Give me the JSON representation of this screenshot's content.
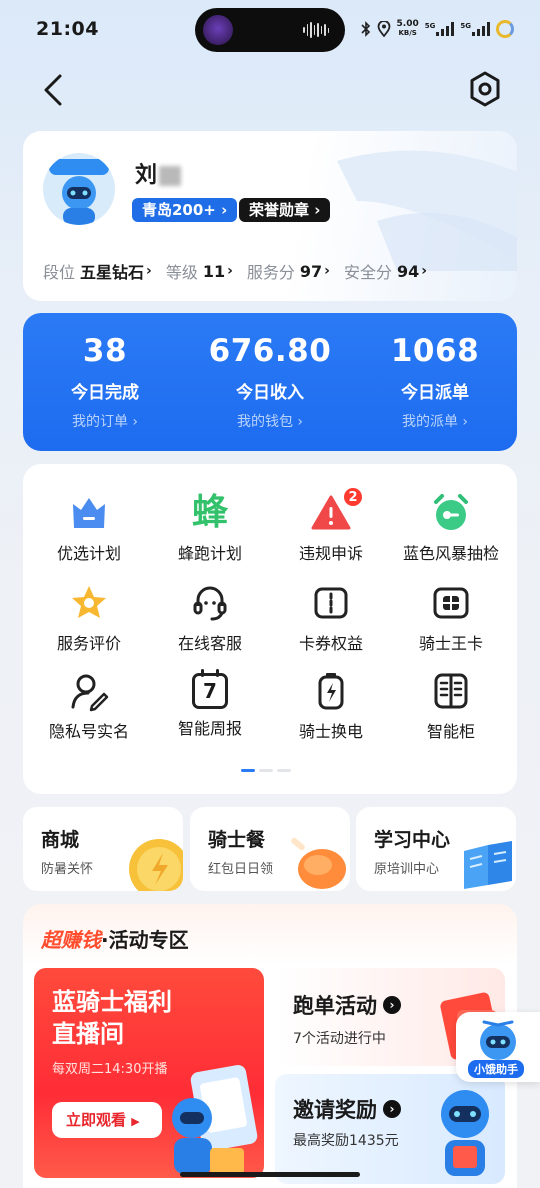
{
  "status_bar": {
    "time": "21:04",
    "speed_value": "5.00",
    "speed_unit": "KB/S",
    "net1": "5G",
    "net2": "5G"
  },
  "nav": {
    "back_icon": "chevron-left-icon",
    "settings_icon": "hexagon-settings-icon"
  },
  "profile": {
    "name_visible": "刘",
    "badge_city": "青岛200+",
    "badge_honor": "荣誉勋章",
    "stats": [
      {
        "label": "段位",
        "value": "五星钻石"
      },
      {
        "label": "等级",
        "value": "11"
      },
      {
        "label": "服务分",
        "value": "97"
      },
      {
        "label": "安全分",
        "value": "94"
      }
    ]
  },
  "summary": {
    "cols": [
      {
        "value": "38",
        "label": "今日完成",
        "link": "我的订单"
      },
      {
        "value": "676.80",
        "label": "今日收入",
        "link": "我的钱包"
      },
      {
        "value": "1068",
        "label": "今日派单",
        "link": "我的派单"
      }
    ]
  },
  "grid": {
    "items": [
      {
        "label": "优选计划",
        "icon": "crown-icon"
      },
      {
        "label": "蜂跑计划",
        "icon": "bee-icon",
        "icon_text": "蜂"
      },
      {
        "label": "违规申诉",
        "icon": "warning-icon",
        "badge": "2"
      },
      {
        "label": "蓝色风暴抽检",
        "icon": "alarm-clock-icon"
      },
      {
        "label": "服务评价",
        "icon": "star-badge-icon"
      },
      {
        "label": "在线客服",
        "icon": "headset-icon"
      },
      {
        "label": "卡券权益",
        "icon": "coupon-icon"
      },
      {
        "label": "骑士王卡",
        "icon": "sim-card-icon"
      },
      {
        "label": "隐私号实名",
        "icon": "user-edit-icon"
      },
      {
        "label": "智能周报",
        "icon": "calendar-icon",
        "icon_text": "7"
      },
      {
        "label": "骑士换电",
        "icon": "battery-swap-icon"
      },
      {
        "label": "智能柜",
        "icon": "locker-icon"
      }
    ],
    "page_index": 1,
    "page_count": 3
  },
  "shop_row": [
    {
      "title": "商城",
      "subtitle": "防暑关怀",
      "icon": "coin-icon"
    },
    {
      "title": "骑士餐",
      "subtitle": "红包日日领",
      "icon": "chicken-leg-icon"
    },
    {
      "title": "学习中心",
      "subtitle": "原培训中心",
      "icon": "book-icon"
    }
  ],
  "activity": {
    "title_hot": "超赚钱",
    "title_rest": "·活动专区",
    "live": {
      "title_line1": "蓝骑士福利",
      "title_line2": "直播间",
      "schedule": "每双周二14:30开播",
      "button": "立即观看"
    },
    "run": {
      "title": "跑单活动",
      "subtitle": "7个活动进行中"
    },
    "invite": {
      "title": "邀请奖励",
      "subtitle": "最高奖励1435元"
    }
  },
  "helper": {
    "label": "小饿助手"
  },
  "colors": {
    "accent": "#1d6cf0",
    "hot": "#ff4d2e",
    "badge_dark": "#151515"
  }
}
